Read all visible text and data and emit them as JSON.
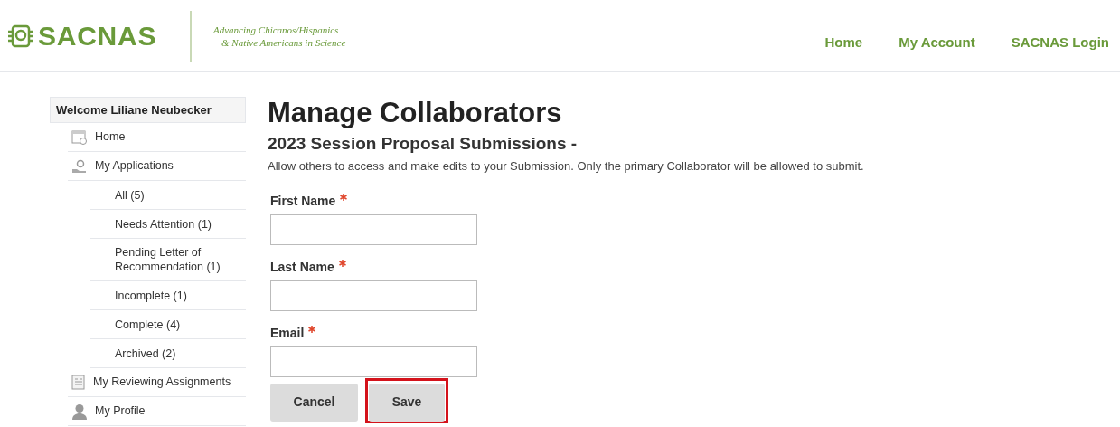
{
  "header": {
    "logo": "SACNAS",
    "tagline": [
      "Advancing Chicanos/Hispanics",
      "& Native Americans in Science"
    ],
    "nav": [
      "Home",
      "My Account",
      "SACNAS Login"
    ]
  },
  "sidebar": {
    "welcome": "Welcome Liliane Neubecker",
    "items": [
      {
        "label": "Home",
        "kind": "home"
      },
      {
        "label": "My Applications",
        "kind": "applications",
        "children": [
          {
            "label": "All (5)"
          },
          {
            "label": "Needs Attention (1)"
          },
          {
            "label": "Pending Letter of Recommendation (1)"
          },
          {
            "label": "Incomplete (1)"
          },
          {
            "label": "Complete (4)"
          },
          {
            "label": "Archived (2)"
          }
        ]
      },
      {
        "label": "My Reviewing Assignments",
        "kind": "reviewing"
      },
      {
        "label": "My Profile",
        "kind": "profile"
      }
    ]
  },
  "main": {
    "title": "Manage Collaborators",
    "subtitle": "2023 Session Proposal Submissions -",
    "description": "Allow others to access and make edits to your Submission. Only the primary Collaborator will be allowed to submit.",
    "fields": [
      {
        "label": "First Name",
        "required": true
      },
      {
        "label": "Last Name",
        "required": true
      },
      {
        "label": "Email",
        "required": true
      }
    ],
    "buttons": [
      {
        "label": "Cancel",
        "highlighted": false
      },
      {
        "label": "Save",
        "highlighted": true
      }
    ]
  }
}
